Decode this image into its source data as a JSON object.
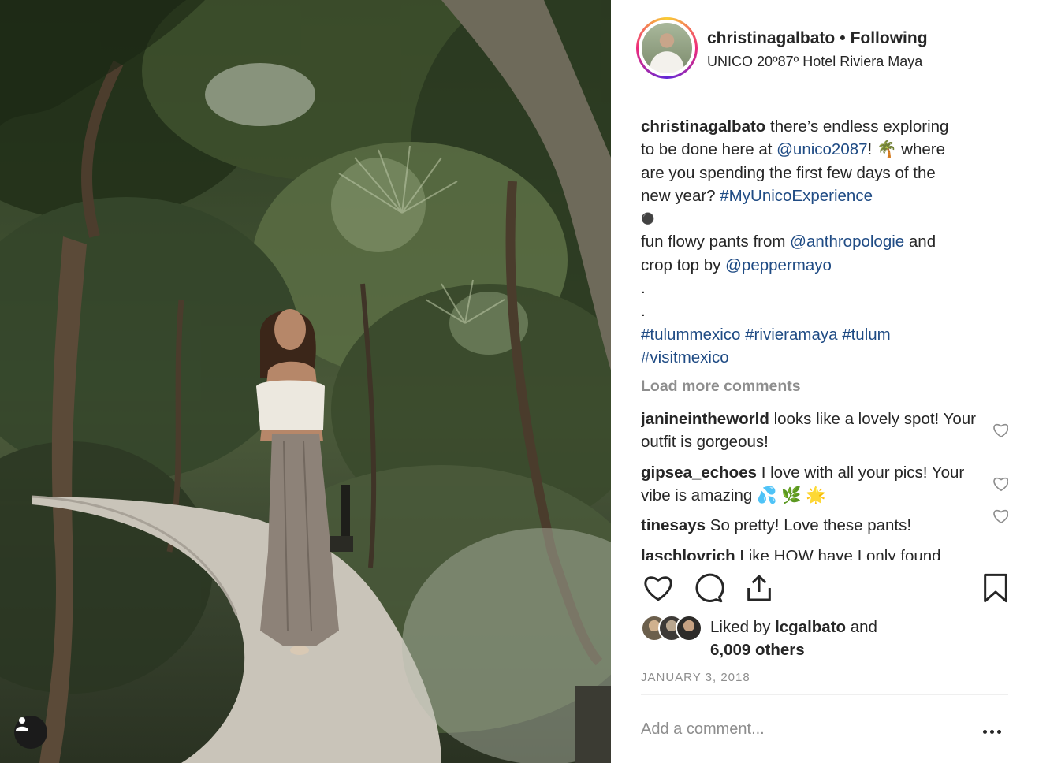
{
  "post": {
    "username": "christinagalbato",
    "separator": "•",
    "follow_label": "Following",
    "location": "UNICO 20º87º Hotel Riviera Maya"
  },
  "caption": {
    "username": "christinagalbato",
    "line1": "there’s endless exploring",
    "line2_pre": "to be done here at ",
    "mention1": "@unico2087",
    "line2_post": "! 🌴  where",
    "line3": "are you spending the first few days of the",
    "line4_pre": "new year? ",
    "hashtag1": "#MyUnicoExperience",
    "bullet": "⚫",
    "line6_pre": "fun flowy pants from ",
    "mention2": "@anthropologie",
    "line6_post": " and",
    "line7_pre": "crop top by ",
    "mention3": "@peppermayo",
    "dot1": ".",
    "dot2": ".",
    "hashtags_line1": "#tulummexico #rivieramaya #tulum",
    "hashtags_line2": "#visitmexico"
  },
  "load_more": "Load more comments",
  "comments": [
    {
      "user": "janineintheworld",
      "text": "looks like a lovely spot! Your outfit is gorgeous!"
    },
    {
      "user": "gipsea_echoes",
      "text": "I love with all your pics! Your vibe is amazing 💦 🌿 🌟"
    },
    {
      "user": "tinesays",
      "text": "So pretty! Love these pants!"
    },
    {
      "user": "laschlovrich",
      "text": "Like HOW have I only found"
    }
  ],
  "likes": {
    "prefix": "Liked by ",
    "user": "lcgalbato",
    "mid": " and",
    "count": "6,009 others"
  },
  "date": "JANUARY 3, 2018",
  "add_comment_placeholder": "Add a comment...",
  "icons": {
    "like": "heart-icon",
    "comment": "comment-icon",
    "share": "share-icon",
    "save": "bookmark-icon",
    "more": "more-options-icon",
    "user_tag": "person-icon"
  },
  "colors": {
    "link": "#1f4b84",
    "muted": "#8e8e8e",
    "text": "#262626"
  }
}
